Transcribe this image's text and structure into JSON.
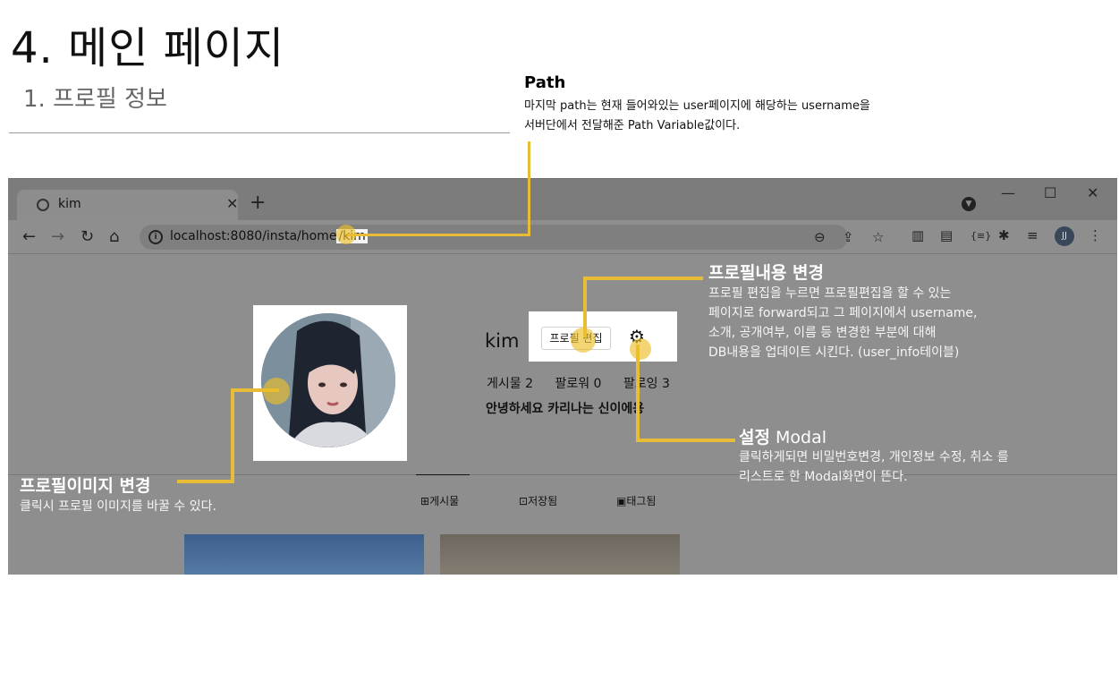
{
  "slide": {
    "title": "4. 메인 페이지",
    "subtitle": "1. 프로필 정보"
  },
  "path_note": {
    "title": "Path",
    "lines": [
      " 마지막 path는 현재 들어와있는 user페이지에 해당하는 username을",
      "서버단에서 전달해준 Path Variable값이다."
    ]
  },
  "browser": {
    "tab_title": "kim",
    "tab_close": "✕",
    "new_tab": "+",
    "window_controls": {
      "minimize": "—",
      "maximize": "☐",
      "close": "✕"
    },
    "nav": {
      "back": "←",
      "forward": "→",
      "reload": "↻",
      "home": "⌂"
    },
    "url_base": "localhost:8080/insta/home",
    "url_highlight": "/kim",
    "info_icon": "i",
    "profile_initials": "JJ"
  },
  "profile": {
    "username": "kim",
    "edit_button": "프로필 편집",
    "gear_icon": "⚙",
    "stats": [
      "게시물 2",
      "팔로워 0",
      "팔로잉 3"
    ],
    "bio": "안녕하세요 카리나는 신이에용",
    "tabs": [
      {
        "icon": "⊞",
        "label": "게시물"
      },
      {
        "icon": "⊡",
        "label": "저장됨"
      },
      {
        "icon": "▣",
        "label": "태그됨"
      }
    ]
  },
  "annotations": {
    "edit_profile": {
      "title": "프로필내용 변경",
      "lines": [
        "프로필 편집을 누르면 프로필편집을 할 수 있는",
        "페이지로 forward되고 그 페이지에서 username,",
        "소개, 공개여부, 이름 등 변경한 부분에 대해",
        "DB내용을 업데이트 시킨다. (user_info테이블)"
      ]
    },
    "settings_modal": {
      "title_bold": "설정",
      "title_rest": " Modal",
      "lines": [
        "클릭하게되면 비밀번호변경, 개인정보 수정, 취소 를",
        "리스트로 한 Modal화면이 뜬다."
      ]
    },
    "profile_image": {
      "title": "프로필이미지 변경",
      "text": "클릭시 프로필 이미지를 바꿀 수 있다."
    }
  },
  "colors": {
    "overlay_gray": "#8e8e8e",
    "annotation_yellow": "#e8bd36"
  }
}
